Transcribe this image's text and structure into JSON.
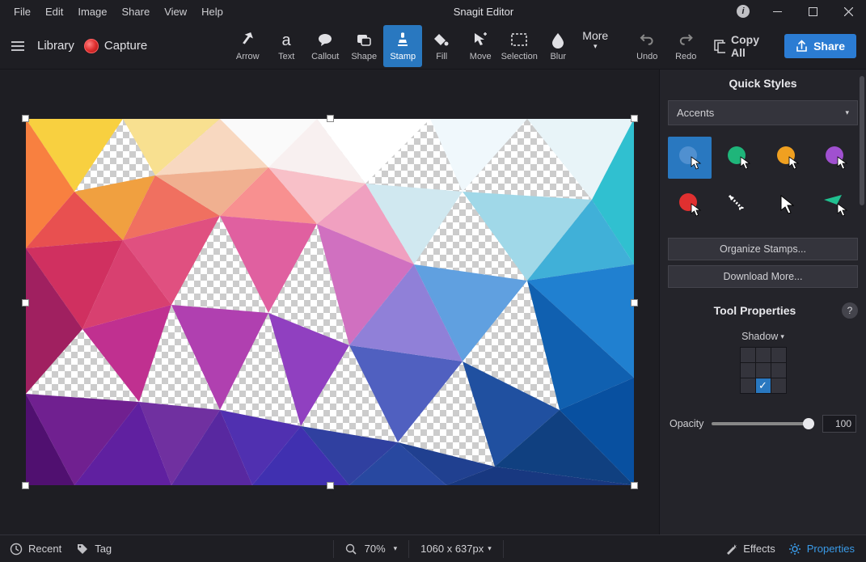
{
  "app": {
    "title": "Snagit Editor"
  },
  "menu": [
    "File",
    "Edit",
    "Image",
    "Share",
    "View",
    "Help"
  ],
  "toolbar": {
    "library": "Library",
    "capture": "Capture",
    "copy_all": "Copy All",
    "share": "Share"
  },
  "tools": [
    {
      "id": "arrow",
      "label": "Arrow"
    },
    {
      "id": "text",
      "label": "Text"
    },
    {
      "id": "callout",
      "label": "Callout"
    },
    {
      "id": "shape",
      "label": "Shape"
    },
    {
      "id": "stamp",
      "label": "Stamp",
      "active": true
    },
    {
      "id": "fill",
      "label": "Fill"
    },
    {
      "id": "move",
      "label": "Move"
    },
    {
      "id": "selection",
      "label": "Selection"
    },
    {
      "id": "blur",
      "label": "Blur"
    },
    {
      "id": "more",
      "label": "More"
    }
  ],
  "undo_redo": {
    "undo": "Undo",
    "redo": "Redo"
  },
  "right_panel": {
    "quick_styles_title": "Quick Styles",
    "accents_label": "Accents",
    "stamps": [
      {
        "color": "#2978c0",
        "selected": true
      },
      {
        "color": "#1fb57a"
      },
      {
        "color": "#f0a020"
      },
      {
        "color": "#a050d0"
      },
      {
        "color": "#e03030"
      },
      {
        "type": "arrow-diag"
      },
      {
        "type": "cursor-plain"
      },
      {
        "color": "#20c090",
        "shape": "triangle"
      }
    ],
    "organize": "Organize Stamps...",
    "download": "Download More...",
    "tool_props_title": "Tool Properties",
    "shadow_label": "Shadow",
    "opacity_label": "Opacity",
    "opacity_value": "100"
  },
  "statusbar": {
    "recent": "Recent",
    "tag": "Tag",
    "zoom": "70%",
    "dimensions": "1060 x 637px",
    "effects": "Effects",
    "properties": "Properties"
  }
}
